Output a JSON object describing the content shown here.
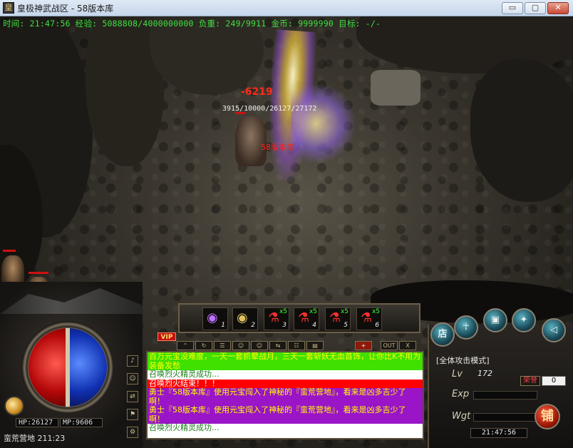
{
  "window": {
    "title": "皇极神武战区 - 58版本库",
    "icon_text": "皇",
    "min_label": "▭",
    "max_label": "▢",
    "close_label": "✕"
  },
  "status": {
    "text": "时间: 21:47:56 经验: 5088808/4000000000 负重: 249/9911 金币: 9999990 目标: -/-"
  },
  "combat": {
    "damage": "-6219",
    "hp_numbers": "3915/10000/26127/27172",
    "player_name": "58版本库"
  },
  "skillbar": {
    "slots": [
      {
        "glyph": "◉",
        "key": "1",
        "count": ""
      },
      {
        "glyph": "◉",
        "key": "2",
        "count": ""
      },
      {
        "glyph": "⚗",
        "key": "3",
        "count": "x5"
      },
      {
        "glyph": "⚗",
        "key": "4",
        "count": "x5"
      },
      {
        "glyph": "⚗",
        "key": "5",
        "count": "x5"
      },
      {
        "glyph": "⚗",
        "key": "6",
        "count": "x5"
      }
    ]
  },
  "toolbar": {
    "vip": "VIP",
    "plus": "+",
    "out": "OUT",
    "close": "X"
  },
  "chat": {
    "lines": [
      "百万元宝没难度，一天一套抓晕战月，三天一套斩妖无血首饰，让你比K不用为装备发愁",
      "召唤烈火精灵成功...",
      "召唤烈火结束！！！",
      "勇士『58版本库』使用元宝闯入了神秘的『蛮荒营地』，看来是凶多吉少了啊！",
      "勇士『58版本库』使用元宝闯入了神秘的『蛮荒营地』，看来是凶多吉少了啊！",
      "召唤烈火精灵成功..."
    ]
  },
  "left_hud": {
    "hp": "HP:26127",
    "mp": "MP:9606",
    "map": "蛮荒营地  211:23"
  },
  "right_hud": {
    "shop": "店",
    "attack_mode": "[全体攻击模式]",
    "lv_label": "Lv",
    "lv_value": "172",
    "exp_label": "Exp",
    "wgt_label": "Wgt",
    "honor_label": "荣誉",
    "honor_value": "0",
    "clock": "21:47:56",
    "pawn": "铺"
  }
}
